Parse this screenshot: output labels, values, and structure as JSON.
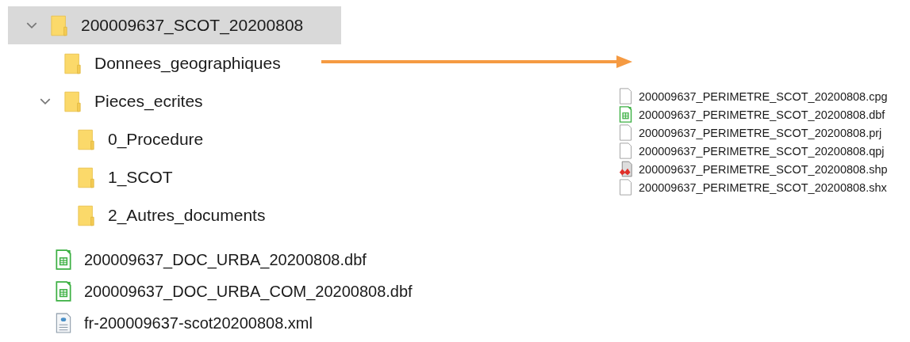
{
  "tree": [
    {
      "name": "200009637_SCOT_20200808",
      "selected": true,
      "expanded": true,
      "children": [
        {
          "name": "Donnees_geographiques",
          "selected": false
        },
        {
          "name": "Pieces_ecrites",
          "selected": false,
          "expanded": true,
          "children": [
            {
              "name": "0_Procedure",
              "selected": false
            },
            {
              "name": "1_SCOT",
              "selected": false
            },
            {
              "name": "2_Autres_documents",
              "selected": false
            }
          ]
        }
      ]
    }
  ],
  "files": [
    {
      "name": "200009637_DOC_URBA_20200808.dbf",
      "kind": "spreadsheet"
    },
    {
      "name": "200009637_DOC_URBA_COM_20200808.dbf",
      "kind": "spreadsheet"
    },
    {
      "name": "fr-200009637-scot20200808.xml",
      "kind": "xml"
    }
  ],
  "geographic_files": [
    {
      "name": "200009637_PERIMETRE_SCOT_20200808.cpg",
      "kind": "file"
    },
    {
      "name": "200009637_PERIMETRE_SCOT_20200808.dbf",
      "kind": "spreadsheet"
    },
    {
      "name": "200009637_PERIMETRE_SCOT_20200808.prj",
      "kind": "file"
    },
    {
      "name": "200009637_PERIMETRE_SCOT_20200808.qpj",
      "kind": "file"
    },
    {
      "name": "200009637_PERIMETRE_SCOT_20200808.shp",
      "kind": "shapefile"
    },
    {
      "name": "200009637_PERIMETRE_SCOT_20200808.shx",
      "kind": "file"
    }
  ]
}
